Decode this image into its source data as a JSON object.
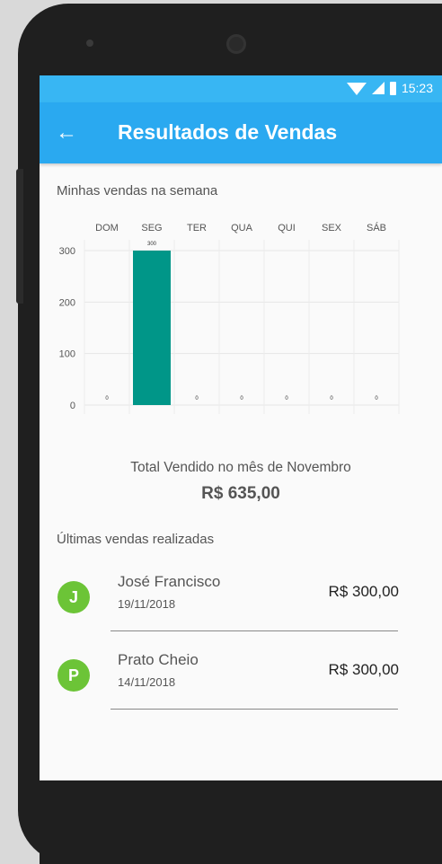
{
  "status_bar": {
    "time": "15:23"
  },
  "app_bar": {
    "title": "Resultados de Vendas",
    "back_icon": "arrow-left-icon"
  },
  "weekly_section": {
    "title": "Minhas vendas na semana"
  },
  "chart_data": {
    "type": "bar",
    "categories": [
      "DOM",
      "SEG",
      "TER",
      "QUA",
      "QUI",
      "SEX",
      "SÁB"
    ],
    "values": [
      0,
      300,
      0,
      0,
      0,
      0,
      0
    ],
    "y_ticks": [
      0,
      100,
      200,
      300
    ],
    "ylim": [
      0,
      300
    ],
    "title": "",
    "xlabel": "",
    "ylabel": "",
    "grid": true,
    "bar_color": "#009688"
  },
  "monthly_total": {
    "label": "Total Vendido no mês de Novembro",
    "value": "R$ 635,00"
  },
  "recent_sales": {
    "title": "Últimas vendas realizadas",
    "items": [
      {
        "initial": "J",
        "name": "José Francisco",
        "date": "19/11/2018",
        "amount": "R$ 300,00"
      },
      {
        "initial": "P",
        "name": "Prato Cheio",
        "date": "14/11/2018",
        "amount": "R$ 300,00"
      }
    ]
  },
  "colors": {
    "status_bar": "#38b6f3",
    "app_bar": "#2aa9f0",
    "avatar": "#6cc437",
    "bar": "#009688"
  }
}
